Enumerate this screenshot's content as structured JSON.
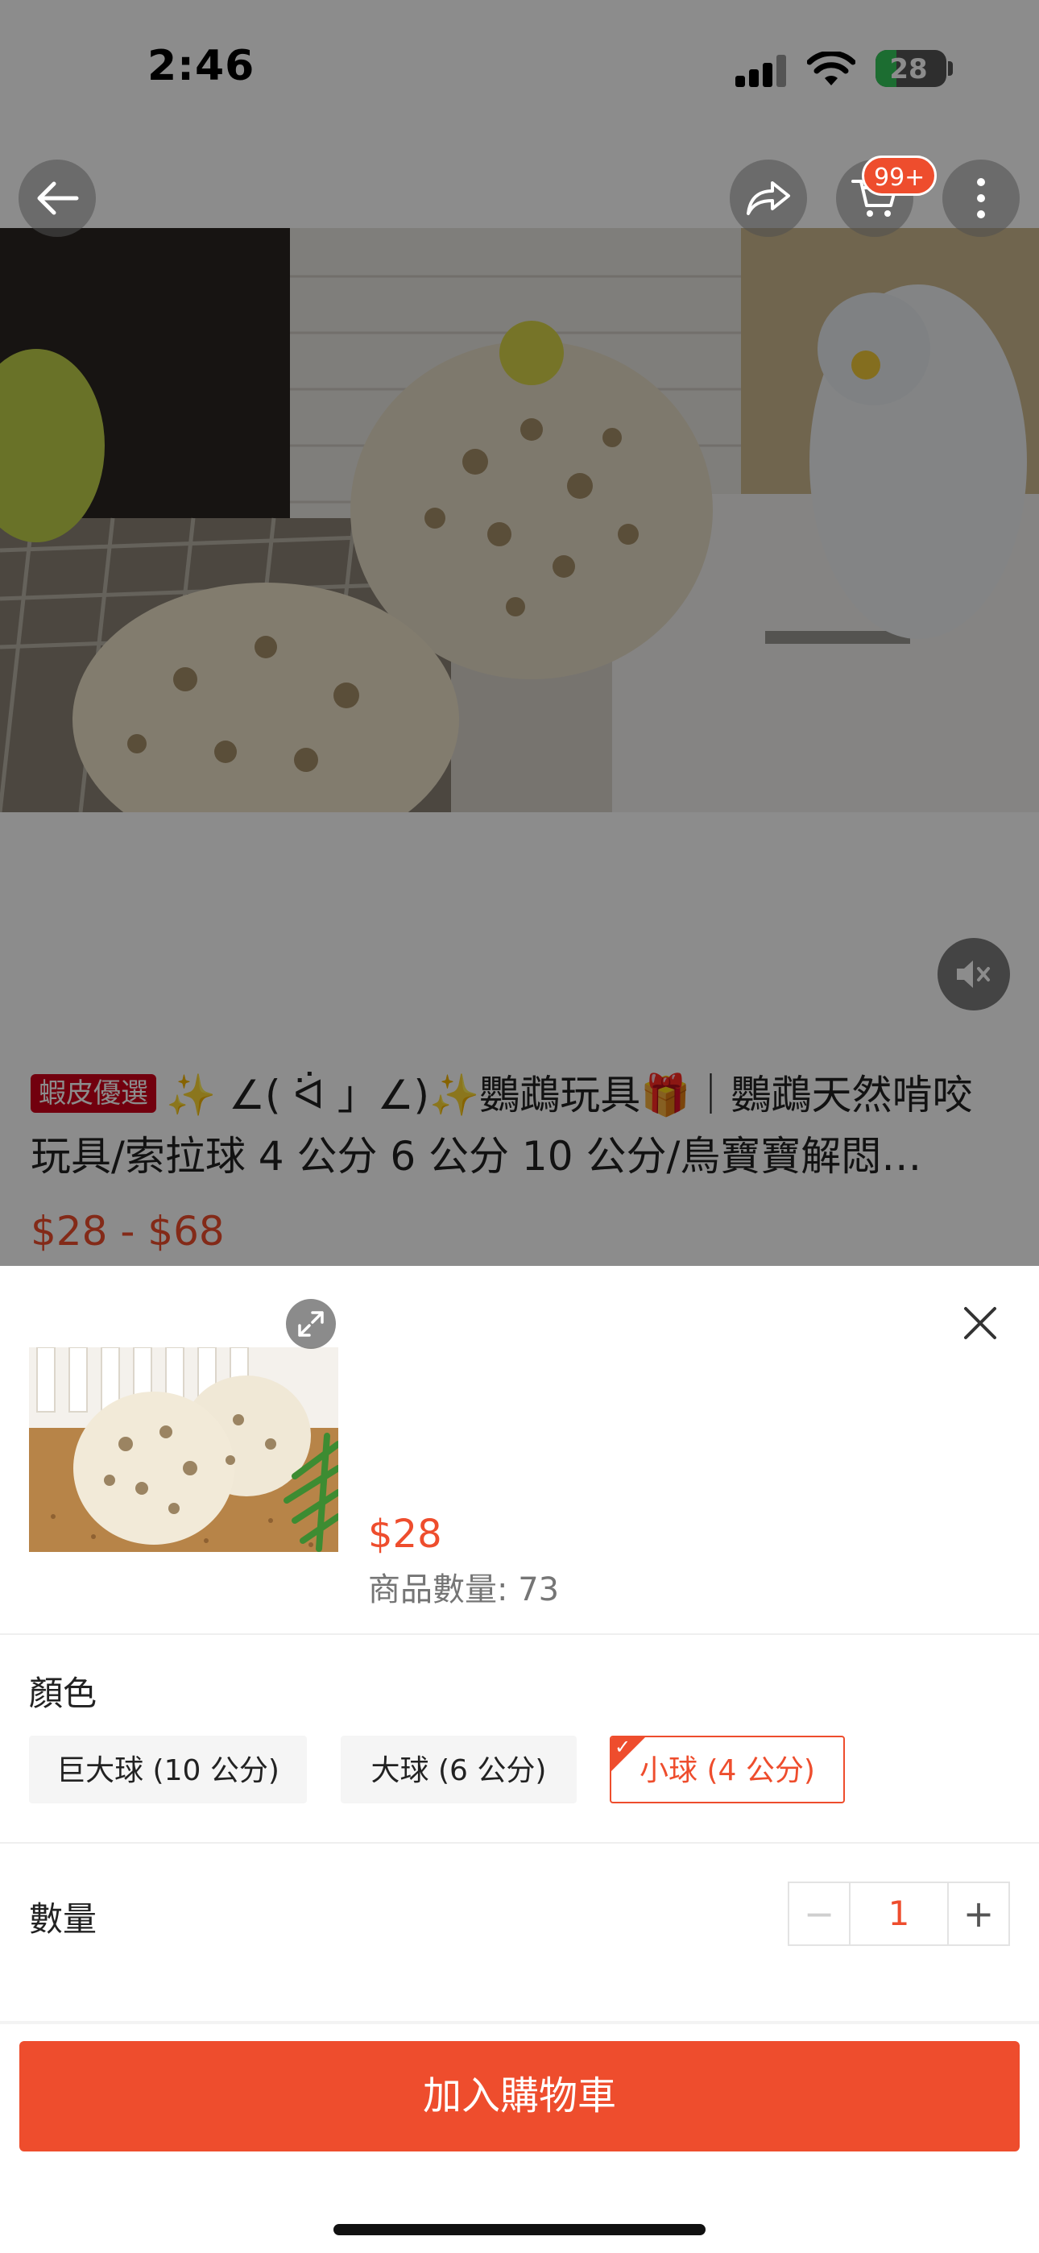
{
  "status_bar": {
    "time": "2:46",
    "battery": "28"
  },
  "header": {
    "back_icon": "arrow-left-icon",
    "share_icon": "share-icon",
    "cart_icon": "shopping-cart-icon",
    "cart_badge": "99+",
    "more_icon": "vertical-ellipsis-icon"
  },
  "media": {
    "mute_icon": "speaker-muted-icon"
  },
  "product": {
    "badge": "蝦皮優選",
    "title": "✨ ∠( ᐛ 」∠)✨鸚鵡玩具🎁｜鸚鵡天然啃咬玩具/索拉球 4 公分 6 公分 10 公分/鳥寶寶解悶…",
    "price_range": "$28 - $68"
  },
  "sheet": {
    "price": "$28",
    "stock": "商品數量: 73",
    "color_label": "顏色",
    "variations": [
      {
        "label": "巨大球 (10 公分)",
        "selected": false
      },
      {
        "label": "大球 (6 公分)",
        "selected": false
      },
      {
        "label": "小球 (4 公分)",
        "selected": true
      }
    ],
    "quantity_label": "數量",
    "quantity": "1",
    "minus": "−",
    "plus": "+",
    "add_to_cart": "加入購物車",
    "selected_check": "✓"
  },
  "colors": {
    "accent": "#ee4d2d",
    "overlay": "rgba(0,0,0,0.45)"
  }
}
